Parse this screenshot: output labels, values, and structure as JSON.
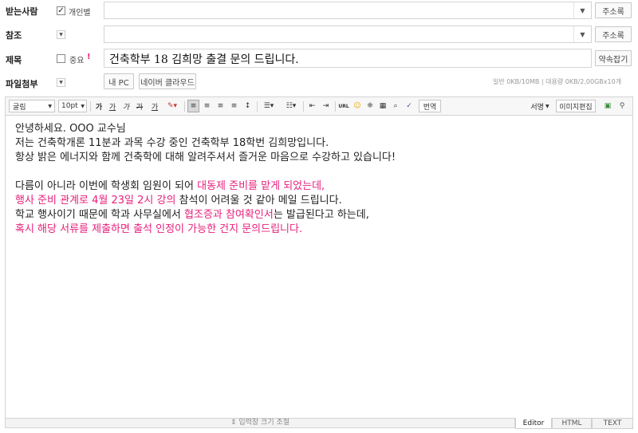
{
  "recipient": {
    "label": "받는사람",
    "personal_checkbox_label": "개인별",
    "personal_checked": true,
    "address_book": "주소록"
  },
  "cc": {
    "label": "참조",
    "address_book": "주소록"
  },
  "subject": {
    "label": "제목",
    "important_label": "중요",
    "important_mark": "!",
    "value": "건축학부 18 김희망 출결 문의 드립니다.",
    "appointment_button": "약속잡기"
  },
  "attachment": {
    "label": "파일첨부",
    "my_pc": "내 PC",
    "naver_cloud": "네이버 클라우드",
    "quota": "일반 0KB/10MB  |  대용량 0KB/2,00GBx10개"
  },
  "toolbar": {
    "font": "굴림",
    "size": "10pt",
    "bold": "가",
    "underline": "가",
    "italic": "가",
    "strike": "가",
    "color": "가",
    "translate": "번역",
    "signature": "서명",
    "image_edit": "이미지편집",
    "url": "URL"
  },
  "body": {
    "line1": "안녕하세요. OOO 교수님",
    "line2": "저는 건축학개론 11분과 과목 수강 중인 건축학부 18학번 김희망입니다.",
    "line3": "항상 밝은 에너지와 함께 건축학에 대해 알려주셔서 즐거운 마음으로 수강하고 있습니다!",
    "line5a": "다름이 아니라 이번에 학생회 임원이 되어 ",
    "line5b": "대동제 준비를 맡게 되었는데,",
    "line6a": "행사 준비 관계로 4월 23일 2시 강의",
    "line6b": " 참석이 어려울 것 같아 메일 드립니다.",
    "line7a": "학교 행사이기 때문에 학과 사무실에서 ",
    "line7b": "협조증과 참여확인서",
    "line7c": "는 발급된다고 하는데,",
    "line8": "혹시 해당 서류를 제출하면 출석 인정이 가능한 건지 문의드립니다."
  },
  "footer": {
    "resize": "⇕ 입력창 크기 조절",
    "tab_editor": "Editor",
    "tab_html": "HTML",
    "tab_text": "TEXT"
  },
  "colors": {
    "highlight": "#e8207c",
    "important": "#e8207c"
  }
}
